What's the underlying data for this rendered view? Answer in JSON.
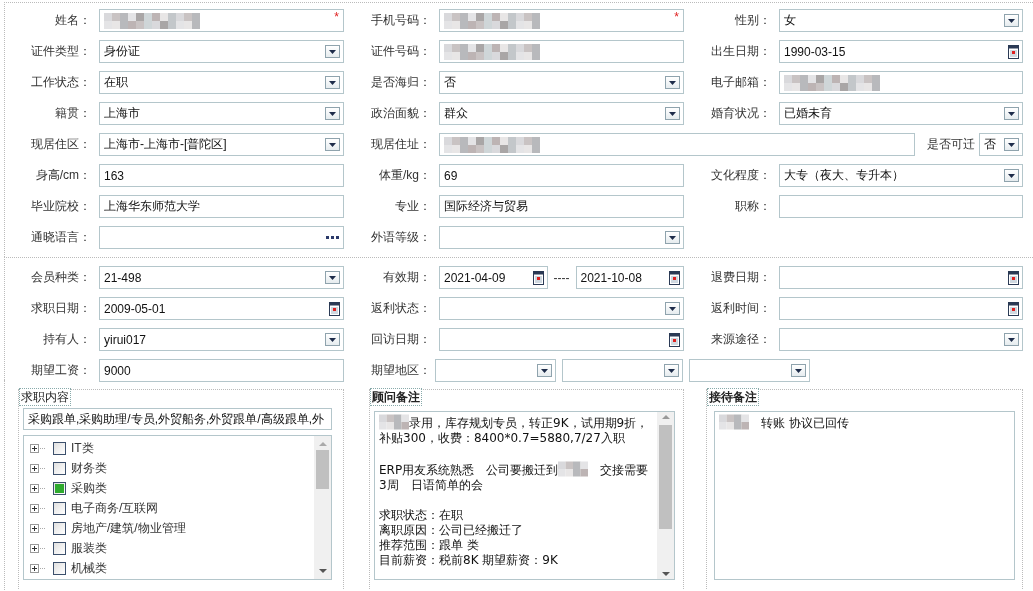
{
  "personal": {
    "rows": [
      {
        "cells": [
          {
            "label": "姓名：",
            "field": {
              "kind": "text",
              "redacted": true,
              "required_mark": "*"
            }
          },
          {
            "label": "手机号码：",
            "field": {
              "kind": "text",
              "redacted": true,
              "required_mark": "*"
            }
          },
          {
            "label": "性别：",
            "field": {
              "kind": "select",
              "value": "女"
            }
          }
        ]
      },
      {
        "cells": [
          {
            "label": "证件类型：",
            "field": {
              "kind": "select",
              "value": "身份证"
            }
          },
          {
            "label": "证件号码：",
            "field": {
              "kind": "text",
              "redacted": true
            }
          },
          {
            "label": "出生日期：",
            "field": {
              "kind": "date",
              "value": "1990-03-15"
            }
          }
        ]
      },
      {
        "cells": [
          {
            "label": "工作状态：",
            "field": {
              "kind": "select",
              "value": "在职"
            }
          },
          {
            "label": "是否海归：",
            "field": {
              "kind": "select",
              "value": "否"
            }
          },
          {
            "label": "电子邮箱：",
            "field": {
              "kind": "text",
              "redacted": true
            }
          }
        ]
      },
      {
        "cells": [
          {
            "label": "籍贯：",
            "field": {
              "kind": "select",
              "value": "上海市"
            }
          },
          {
            "label": "政治面貌：",
            "field": {
              "kind": "select",
              "value": "群众"
            }
          },
          {
            "label": "婚育状况：",
            "field": {
              "kind": "select",
              "value": "已婚未育"
            }
          }
        ]
      },
      {
        "cells": [
          {
            "label": "现居住区：",
            "field": {
              "kind": "select",
              "value": "上海市-上海市-[普陀区]"
            }
          },
          {
            "label": "现居住址：",
            "field": {
              "kind": "text",
              "redacted": true
            },
            "extra": {
              "label": "是否可迁",
              "field": {
                "kind": "select",
                "value": "否"
              }
            }
          }
        ]
      },
      {
        "cells": [
          {
            "label": "身高/cm：",
            "field": {
              "kind": "text",
              "value": "163"
            }
          },
          {
            "label": "体重/kg：",
            "field": {
              "kind": "text",
              "value": "69"
            }
          },
          {
            "label": "文化程度：",
            "field": {
              "kind": "select",
              "value": "大专（夜大、专升本）"
            }
          }
        ]
      },
      {
        "cells": [
          {
            "label": "毕业院校：",
            "field": {
              "kind": "text",
              "value": "上海华东师范大学"
            }
          },
          {
            "label": "专业：",
            "field": {
              "kind": "text",
              "value": "国际经济与贸易"
            }
          },
          {
            "label": "职称：",
            "field": {
              "kind": "text"
            }
          }
        ]
      },
      {
        "cells": [
          {
            "label": "通晓语言：",
            "field": {
              "kind": "picker"
            }
          },
          {
            "label": "外语等级：",
            "field": {
              "kind": "select"
            }
          }
        ]
      }
    ]
  },
  "membership": {
    "rows": [
      {
        "cells": [
          {
            "label": "会员种类：",
            "field": {
              "kind": "select",
              "value": "21-498"
            }
          },
          {
            "label": "有效期：",
            "field": {
              "kind": "date_range",
              "from": "2021-04-09",
              "separator": "----",
              "to": "2021-10-08"
            }
          },
          {
            "label": "退费日期：",
            "field": {
              "kind": "date"
            }
          }
        ]
      },
      {
        "cells": [
          {
            "label": "求职日期：",
            "field": {
              "kind": "date",
              "value": "2009-05-01"
            }
          },
          {
            "label": "返利状态：",
            "field": {
              "kind": "select"
            }
          },
          {
            "label": "返利时间：",
            "field": {
              "kind": "date"
            }
          }
        ]
      },
      {
        "cells": [
          {
            "label": "持有人：",
            "field": {
              "kind": "select",
              "value": "yirui017"
            }
          },
          {
            "label": "回访日期：",
            "field": {
              "kind": "date"
            }
          },
          {
            "label": "来源途径：",
            "field": {
              "kind": "select"
            }
          }
        ]
      },
      {
        "cells": [
          {
            "label": "期望工资：",
            "field": {
              "kind": "text",
              "value": "9000"
            }
          },
          {
            "label": "期望地区：",
            "field": {
              "kind": "multi_select",
              "selects": [
                {
                  "kind": "select"
                },
                {
                  "kind": "select"
                },
                {
                  "kind": "select"
                }
              ]
            }
          }
        ]
      }
    ]
  },
  "job_content": {
    "title": "求职内容",
    "summary": "采购跟单,采购助理/专员,外贸船务,外贸跟单/高级跟单,外",
    "categories": [
      {
        "label": "IT类",
        "expanded": false,
        "checked": false
      },
      {
        "label": "财务类",
        "expanded": false,
        "checked": false
      },
      {
        "label": "采购类",
        "expanded": false,
        "checked": true
      },
      {
        "label": "电子商务/互联网",
        "expanded": false,
        "checked": false
      },
      {
        "label": "房地产/建筑/物业管理",
        "expanded": false,
        "checked": false
      },
      {
        "label": "服装类",
        "expanded": false,
        "checked": false
      },
      {
        "label": "机械类",
        "expanded": false,
        "checked": false
      }
    ]
  },
  "notes": [
    {
      "title": "顾问备注",
      "scrollable": true,
      "blocks": [
        {
          "lines": [
            [
              {
                "kind": "redacted"
              },
              {
                "kind": "text",
                "text": "录用，库存规划专员，转正9K，试用期9折，补贴300，收费：8400*0.7=5880,7/27入职"
              }
            ]
          ]
        },
        {
          "lines": [
            [
              {
                "kind": "text",
                "text": "ERP用友系统熟悉　公司要搬迁到"
              },
              {
                "kind": "redacted"
              },
              {
                "kind": "text",
                "text": "　交接需要3周　日语简单的会"
              }
            ]
          ]
        },
        {
          "lines": [
            [
              {
                "kind": "text",
                "text": "求职状态：在职"
              }
            ],
            [
              {
                "kind": "text",
                "text": "离职原因：公司已经搬迁了"
              }
            ],
            [
              {
                "kind": "text",
                "text": "推荐范围：跟单 类"
              }
            ],
            [
              {
                "kind": "text",
                "text": "目前薪资：税前8K 期望薪资：9K"
              }
            ]
          ]
        }
      ]
    },
    {
      "title": "接待备注",
      "scrollable": false,
      "blocks": [
        {
          "lines": [
            [
              {
                "kind": "redacted"
              },
              {
                "kind": "text",
                "text": "　转账 协议已回传"
              }
            ]
          ]
        }
      ]
    }
  ]
}
